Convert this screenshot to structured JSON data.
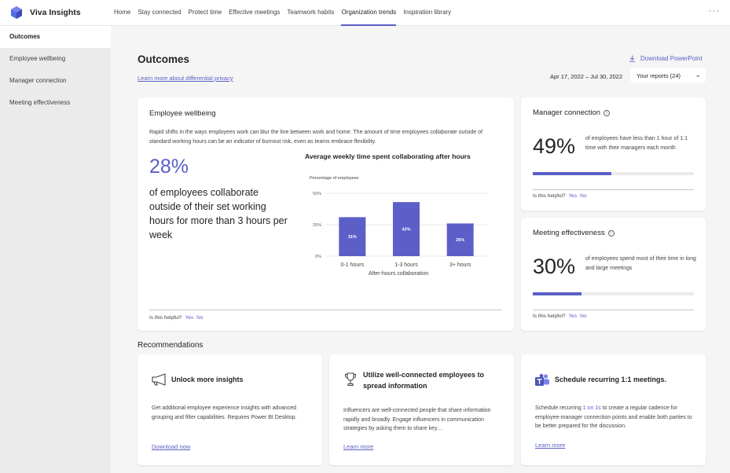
{
  "app": {
    "title": "Viva Insights",
    "more_label": "···"
  },
  "nav": {
    "items": [
      {
        "label": "Home"
      },
      {
        "label": "Stay connected"
      },
      {
        "label": "Protect time"
      },
      {
        "label": "Effective meetings"
      },
      {
        "label": "Teamwork habits"
      },
      {
        "label": "Organization trends"
      },
      {
        "label": "Inspiration library"
      }
    ],
    "active": "Organization trends"
  },
  "sidebar": {
    "items": [
      {
        "label": "Outcomes"
      },
      {
        "label": "Employee wellbeing"
      },
      {
        "label": "Manager connection"
      },
      {
        "label": "Meeting effectiveness"
      }
    ]
  },
  "header": {
    "title": "Outcomes",
    "learn_link": "Learn more about differential privacy",
    "download_label": "Download PowerPoint",
    "date_range": "Apr 17, 2022 – Jul 30, 2022",
    "reports_label": "Your reports (24)"
  },
  "wellbeing": {
    "title": "Employee wellbeing",
    "description": "Rapid shifts in the ways employees work can blur the line between work and home. The amount of time employees collaborate outside of standard working hours can be an indicator of burnout risk, even as teams embrace flexibility.",
    "percent": "28%",
    "stat_text": "of employees collaborate outside of their set working hours for more than 3 hours per week",
    "helpful_label": "Is this helpful?",
    "yes": "Yes",
    "no": "No"
  },
  "chart_data": {
    "type": "bar",
    "title": "Average weekly time spent collaborating after hours",
    "ylabel": "Percentage of employees",
    "xlabel": "After-hours collaboration",
    "categories": [
      "0-1 hours",
      "1-3 hours",
      "3+ hours"
    ],
    "values": [
      31,
      43,
      26
    ],
    "data_labels": [
      "31%",
      "43%",
      "26%"
    ],
    "yticks": [
      "50%",
      "25%",
      "0%"
    ],
    "ytick_values": [
      50,
      25,
      0
    ],
    "ylim": [
      0,
      50
    ],
    "bar_color": "#5b5fc7",
    "grid": true
  },
  "manager": {
    "title": "Manager connection",
    "percent": "49%",
    "percent_value": 0.49,
    "text": "of employees have less than 1 hour of 1:1 time with their managers each month",
    "helpful_label": "Is this helpful?",
    "yes": "Yes",
    "no": "No"
  },
  "meeting": {
    "title": "Meeting effectiveness",
    "percent": "30%",
    "percent_value": 0.3,
    "text": "of employees spend most of their time in long and large meetings",
    "helpful_label": "Is this helpful?",
    "yes": "Yes",
    "no": "No"
  },
  "recommendations": {
    "heading": "Recommendations",
    "cards": [
      {
        "icon": "megaphone-icon",
        "title": "Unlock more insights",
        "body": "Get additional employee experience insights with advanced grouping and filter capabilities. Requires Power BI Desktop.",
        "link": "Download now"
      },
      {
        "icon": "trophy-icon",
        "title": "Utilize well-connected employees to spread information",
        "body": "Influencers are well-connected people that share information rapidly and broadly. Engage influencers in communication strategies by asking them to share key…",
        "link": "Learn more"
      },
      {
        "icon": "teams-icon",
        "title": "Schedule recurring 1:1 meetings.",
        "body_prefix": "Schedule recurring",
        "body_highlight": "1 on 1s",
        "body_suffix": "to create a regular cadence for employee-manager connection points and enable both parties to be better prepared for the discussion.",
        "link": "Learn more"
      }
    ]
  },
  "colors": {
    "accent": "#5b5fc7",
    "background": "#f5f5f5",
    "sidebar": "#ebebeb"
  }
}
